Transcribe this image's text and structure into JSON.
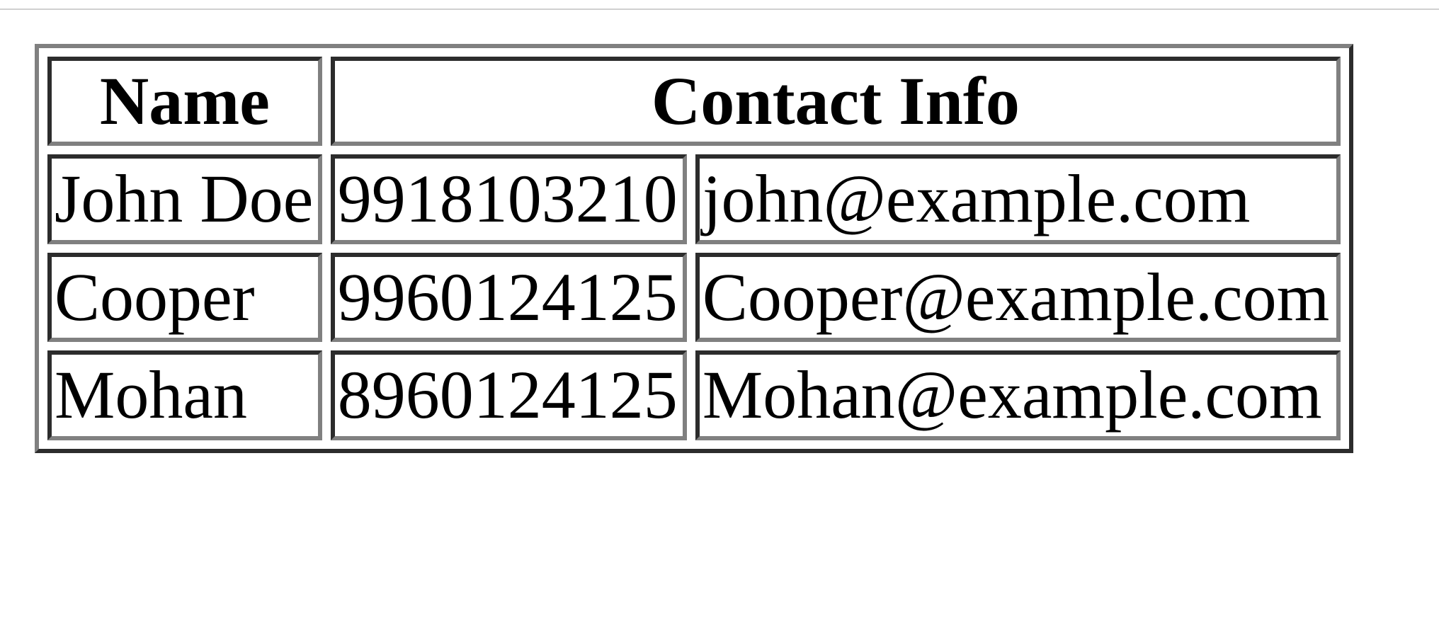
{
  "table": {
    "headers": {
      "name": "Name",
      "contact": "Contact Info"
    },
    "rows": [
      {
        "name": "John Doe",
        "phone": "9918103210",
        "email": "john@example.com"
      },
      {
        "name": "Cooper",
        "phone": "9960124125",
        "email": "Cooper@example.com"
      },
      {
        "name": "Mohan",
        "phone": "8960124125",
        "email": "Mohan@example.com"
      }
    ]
  }
}
